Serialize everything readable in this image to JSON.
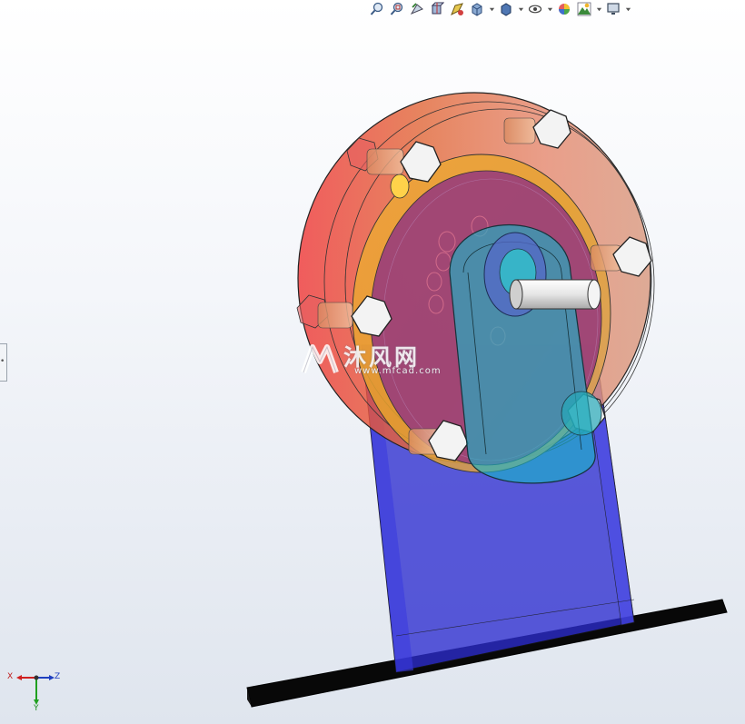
{
  "toolbar": {
    "buttons": [
      {
        "name": "zoom-to-fit-icon"
      },
      {
        "name": "zoom-to-area-icon"
      },
      {
        "name": "previous-view-icon"
      },
      {
        "name": "section-view-icon"
      },
      {
        "name": "dynamic-annotation-icon"
      },
      {
        "name": "view-orientation-icon",
        "dropdown": true
      },
      {
        "name": "display-style-icon",
        "dropdown": true
      },
      {
        "name": "hide-show-items-icon",
        "dropdown": true
      },
      {
        "name": "edit-appearance-icon"
      },
      {
        "name": "apply-scene-icon",
        "dropdown": true
      },
      {
        "name": "view-settings-icon",
        "dropdown": true
      }
    ]
  },
  "watermark": {
    "title": "沐风网",
    "url": "www.mfcad.com"
  },
  "triad": {
    "x_label": "X",
    "z_label": "Z",
    "y_label": "Y"
  },
  "colors": {
    "base_plate": "#111111",
    "bracket": "#3b3bd0",
    "arm": "#1fb8c8",
    "disk_outer": "#e05050",
    "disk_inner": "#a0407a",
    "shaft": "#f4f4f4",
    "bolt_head": "#f2f2f2"
  }
}
